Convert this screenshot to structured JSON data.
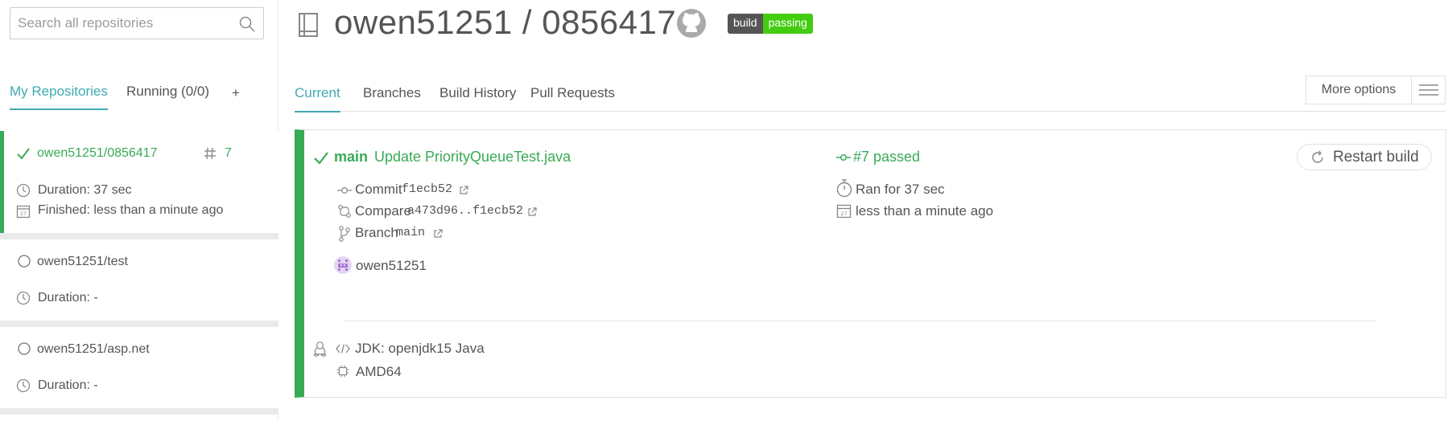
{
  "sidebar": {
    "search_placeholder": "Search all repositories",
    "tabs": {
      "my_repositories": "My Repositories",
      "running": "Running (0/0)",
      "add": "+"
    },
    "repos": [
      {
        "name": "owen51251/0856417",
        "build_number": "7",
        "duration": "Duration: 37 sec",
        "finished": "Finished: less than a minute ago",
        "status": "passed"
      },
      {
        "name": "owen51251/test",
        "duration": "Duration: -"
      },
      {
        "name": "owen51251/asp.net",
        "duration": "Duration: -"
      }
    ]
  },
  "header": {
    "title": "owen51251 / 0856417",
    "badge_left": "build",
    "badge_right": "passing"
  },
  "tabs": [
    "Current",
    "Branches",
    "Build History",
    "Pull Requests"
  ],
  "more_options": "More options",
  "build": {
    "branch": "main",
    "message": "Update PriorityQueueTest.java",
    "status": "#7 passed",
    "restart_label": "Restart build",
    "commit_label": "Commit",
    "commit_sha": "f1ecb52",
    "compare_label": "Compare",
    "compare_range": "a473d96..f1ecb52",
    "branch_label": "Branch",
    "branch_name": "main",
    "author": "owen51251",
    "ran_for": "Ran for 37 sec",
    "finished": "less than a minute ago",
    "jdk": "JDK: openjdk15 Java",
    "arch": "AMD64"
  },
  "colors": {
    "accent": "#3eaaaf",
    "passed": "#39aa56",
    "badge_green": "#44cc11"
  }
}
